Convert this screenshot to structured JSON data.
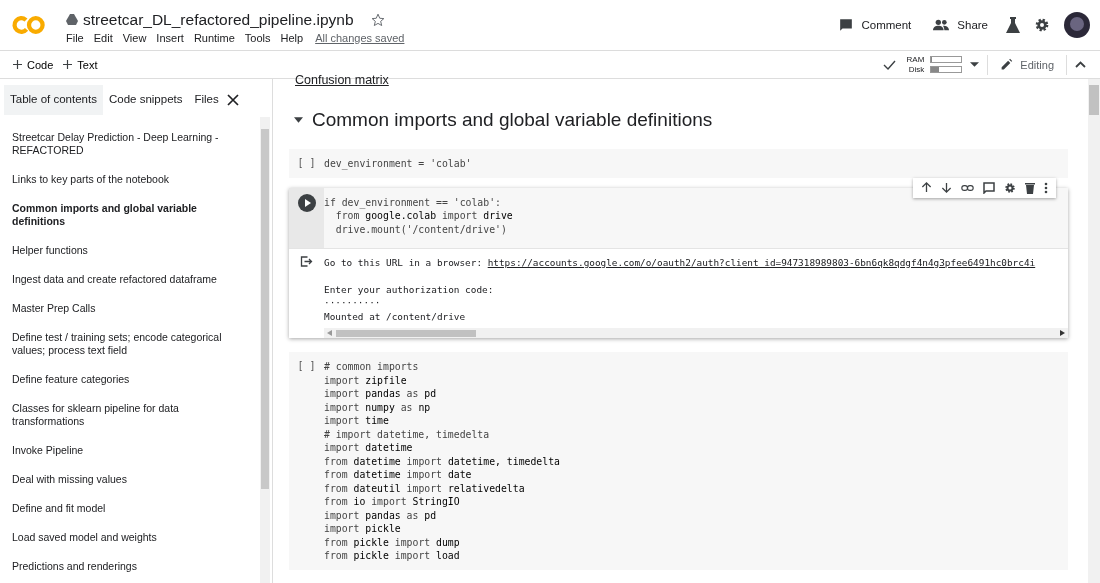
{
  "header": {
    "title": "streetcar_DL_refactored_pipeline.ipynb",
    "menu": [
      "File",
      "Edit",
      "View",
      "Insert",
      "Runtime",
      "Tools",
      "Help"
    ],
    "save_status": "All changes saved",
    "actions": [
      "Comment",
      "Share"
    ]
  },
  "toolbar": {
    "add_buttons": [
      "Code",
      "Text"
    ],
    "resources": [
      {
        "label": "RAM",
        "level": 0.03
      },
      {
        "label": "Disk",
        "level": 0.25
      }
    ],
    "mode": "Editing"
  },
  "sidebar": {
    "tabs": [
      {
        "label": "Table of contents",
        "selected": true
      },
      {
        "label": "Code snippets",
        "selected": false
      },
      {
        "label": "Files",
        "selected": false
      }
    ],
    "items": [
      {
        "label": "Streetcar Delay Prediction - Deep Learning - REFACTORED",
        "selected": false
      },
      {
        "label": "Links to key parts of the notebook",
        "selected": false
      },
      {
        "label": "Common imports and global variable definitions",
        "selected": true
      },
      {
        "label": "Helper functions",
        "selected": false
      },
      {
        "label": "Ingest data and create refactored dataframe",
        "selected": false
      },
      {
        "label": "Master Prep Calls",
        "selected": false
      },
      {
        "label": "Define test / training sets; encode categorical values; process text field",
        "selected": false
      },
      {
        "label": "Define feature categories",
        "selected": false
      },
      {
        "label": "Classes for sklearn pipeline for data transformations",
        "selected": false
      },
      {
        "label": "Invoke Pipeline",
        "selected": false
      },
      {
        "label": "Deal with missing values",
        "selected": false
      },
      {
        "label": "Define and fit model",
        "selected": false
      },
      {
        "label": "Load saved model and weights",
        "selected": false
      },
      {
        "label": "Predictions and renderings",
        "selected": false
      }
    ]
  },
  "notebook": {
    "top_link": "Confusion matrix",
    "section_title": "Common imports and global variable definitions",
    "cells": [
      {
        "kind": "code",
        "run_label": "[ ]",
        "active": false,
        "lines": [
          "dev_environment = 'colab'"
        ]
      },
      {
        "kind": "code",
        "active": true,
        "lines": [
          "if dev_environment == 'colab':",
          "  from **google.colab** import **drive**",
          "  drive.mount('/content/drive')"
        ],
        "output": {
          "prefix": "Go to this URL in a browser: ",
          "link": "https://accounts.google.com/o/oauth2/auth?client_id=947318989803-6bn6qk8qdgf4n4g3pfee6491hc0brc4i",
          "lines": [
            "Enter your authorization code:",
            "··········",
            "Mounted at /content/drive"
          ]
        }
      },
      {
        "kind": "code",
        "run_label": "[ ]",
        "active": false,
        "lines": [
          "# common imports",
          "import **zipfile**",
          "import **pandas** as **pd**",
          "import **numpy** as **np**",
          "import **time**",
          "# import datetime, timedelta",
          "import **datetime**",
          "from **datetime** import **datetime, timedelta**",
          "from **datetime** import **date**",
          "from **dateutil** import **relativedelta**",
          "from **io** import **StringIO**",
          "import **pandas** as **pd**",
          "import **pickle**",
          "from **pickle** import **dump**",
          "from **pickle** import **load**"
        ]
      }
    ]
  }
}
